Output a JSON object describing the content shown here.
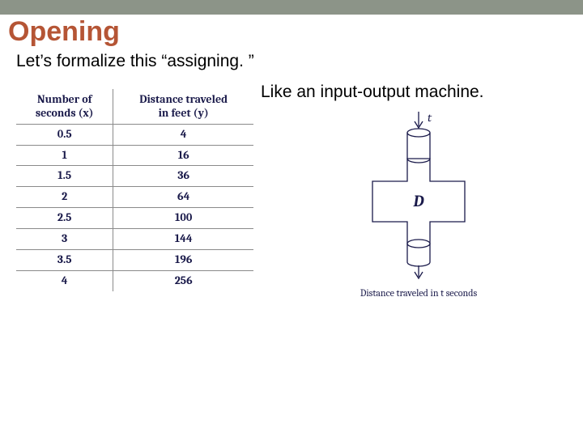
{
  "heading": "Opening",
  "subtitle": "Let’s formalize this “assigning. ”",
  "table": {
    "headers": {
      "col1_line1": "Number of",
      "col1_line2": "seconds (x)",
      "col2_line1": "Distance traveled",
      "col2_line2": "in feet (y)"
    },
    "rows": [
      {
        "x": "0.5",
        "y": "4"
      },
      {
        "x": "1",
        "y": "16"
      },
      {
        "x": "1.5",
        "y": "36"
      },
      {
        "x": "2",
        "y": "64"
      },
      {
        "x": "2.5",
        "y": "100"
      },
      {
        "x": "3",
        "y": "144"
      },
      {
        "x": "3.5",
        "y": "196"
      },
      {
        "x": "4",
        "y": "256"
      }
    ]
  },
  "right": {
    "heading": "Like an input-output machine.",
    "input_label": "t",
    "box_label": "D",
    "caption": "Distance traveled in t seconds"
  },
  "chart_data": {
    "type": "table",
    "title": "Distance traveled vs. seconds",
    "xlabel": "Number of seconds (x)",
    "ylabel": "Distance traveled in feet (y)",
    "categories": [
      "0.5",
      "1",
      "1.5",
      "2",
      "2.5",
      "3",
      "3.5",
      "4"
    ],
    "values": [
      4,
      16,
      36,
      64,
      100,
      144,
      196,
      256
    ]
  }
}
